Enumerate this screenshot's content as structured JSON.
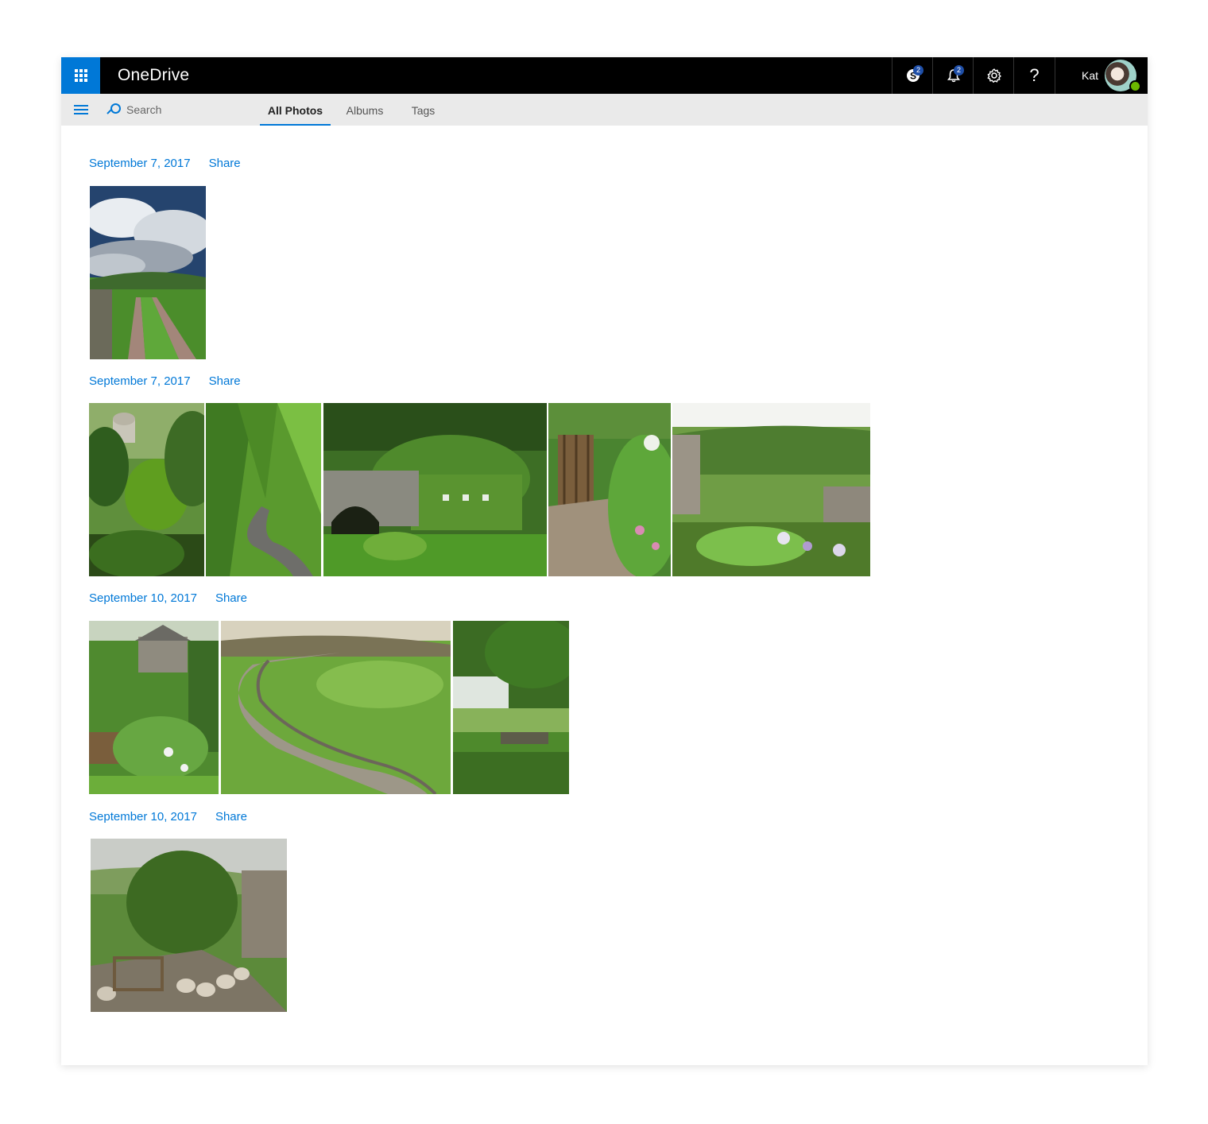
{
  "app": {
    "title": "OneDrive"
  },
  "topbar": {
    "skype_badge": "2",
    "notifications_badge": "2",
    "help_label": "?",
    "user_name": "Kat"
  },
  "cmdbar": {
    "search_placeholder": "Search",
    "tabs": [
      {
        "label": "All Photos",
        "active": true
      },
      {
        "label": "Albums",
        "active": false
      },
      {
        "label": "Tags",
        "active": false
      }
    ]
  },
  "groups": [
    {
      "date": "September 7, 2017",
      "share_label": "Share"
    },
    {
      "date": "September 7, 2017",
      "share_label": "Share"
    },
    {
      "date": "September 10, 2017",
      "share_label": "Share"
    },
    {
      "date": "September 10, 2017",
      "share_label": "Share"
    }
  ],
  "colors": {
    "accent": "#0078d7",
    "topbar": "#000000",
    "cmdbar": "#eaeaea",
    "presence": "#6bb700"
  }
}
